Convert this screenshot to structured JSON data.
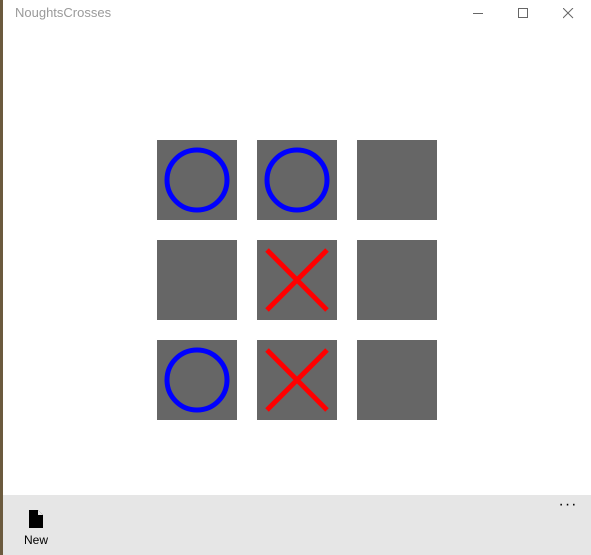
{
  "window": {
    "title": "NoughtsCrosses"
  },
  "board": {
    "cells": [
      [
        "O",
        "O",
        ""
      ],
      [
        "",
        "X",
        ""
      ],
      [
        "O",
        "X",
        ""
      ]
    ]
  },
  "appbar": {
    "new_label": "New",
    "more_label": "···"
  },
  "colors": {
    "cell": "#666666",
    "nought": "#0000ff",
    "cross": "#ff0000",
    "appbar": "#e6e6e6"
  },
  "icons": {
    "new": "new-document-icon",
    "more": "more-icon",
    "minimize": "minimize-icon",
    "maximize": "maximize-icon",
    "close": "close-icon"
  }
}
